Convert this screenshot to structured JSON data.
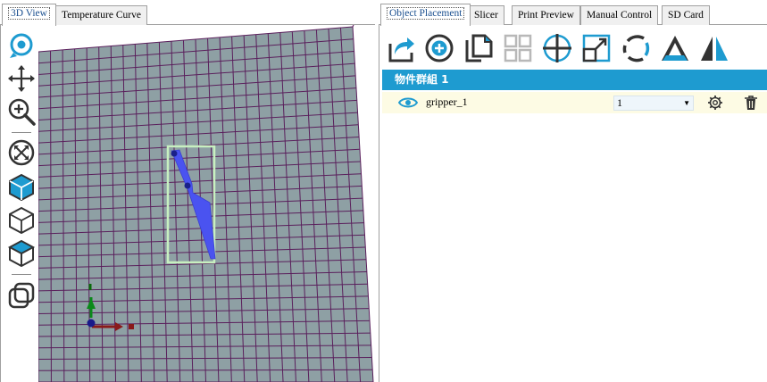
{
  "left_tabs": [
    {
      "label": "3D View",
      "active": true
    },
    {
      "label": "Temperature Curve",
      "active": false
    }
  ],
  "right_tabs": [
    {
      "label": "Object Placement",
      "active": true
    },
    {
      "label": "Slicer",
      "active": false
    },
    {
      "label": "Print Preview",
      "active": false
    },
    {
      "label": "Manual Control",
      "active": false
    },
    {
      "label": "SD Card",
      "active": false
    }
  ],
  "view_tools": [
    "rotate-view-icon",
    "move-view-icon",
    "zoom-view-icon",
    "fit-view-icon",
    "iso-view-icon",
    "front-view-icon",
    "top-view-icon",
    "toggle-objects-icon"
  ],
  "placement_tools": [
    "export-icon",
    "add-object-icon",
    "copy-object-icon",
    "autoposition-icon",
    "center-object-icon",
    "scale-icon",
    "rotate-object-icon",
    "cut-icon",
    "mirror-icon"
  ],
  "colors": {
    "accent": "#1e9bd0",
    "grid_fill": "#8ea0a4",
    "grid_line": "#5a1f5c",
    "object_fill": "#4a53f0",
    "bbox": "#c8f0c0"
  },
  "object_list": {
    "group_title": "物件群組 1",
    "objects": [
      {
        "name": "gripper_1",
        "count": "1",
        "visible": true
      }
    ]
  }
}
